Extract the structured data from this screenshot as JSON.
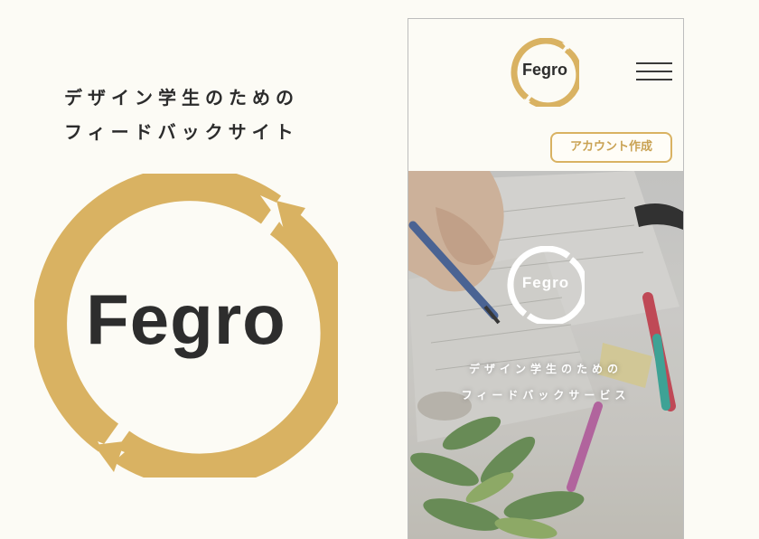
{
  "brand": {
    "name": "Fegro",
    "accent_color": "#d9b262",
    "text_color": "#2d2d2d",
    "background_color": "#fcfbf5"
  },
  "left_panel": {
    "tagline_line1": "デザイン学生のための",
    "tagline_line2": "フィードバックサイト",
    "logo_wordmark": "Fegro"
  },
  "phone": {
    "header": {
      "logo_wordmark": "Fegro",
      "menu_icon": "hamburger-menu-icon",
      "account_button_label": "アカウント作成"
    },
    "hero": {
      "logo_wordmark": "Fegro",
      "line1": "デザイン学生のための",
      "line2": "フィードバックサービス"
    }
  }
}
